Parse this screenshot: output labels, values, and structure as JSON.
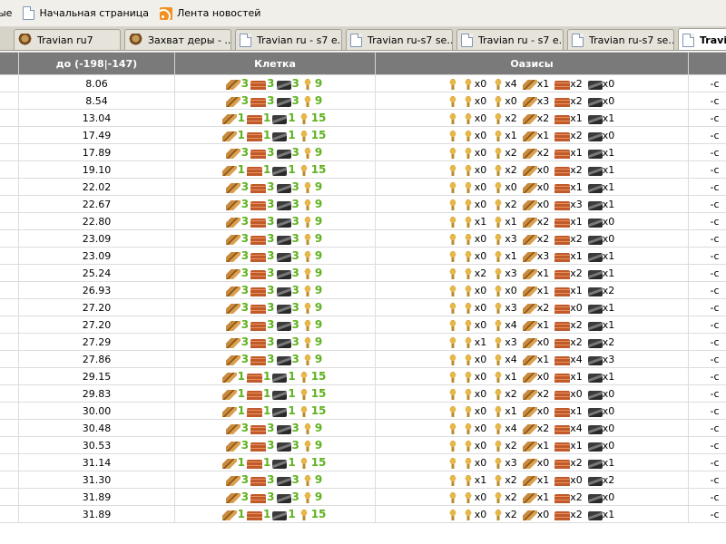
{
  "bookmarks": {
    "items": [
      {
        "label": "ые",
        "icon": "bookmark-item-icon"
      },
      {
        "label": "Начальная страница",
        "icon": "page-icon"
      },
      {
        "label": "Лента новостей",
        "icon": "rss-feed-icon"
      }
    ]
  },
  "tabs": [
    {
      "label": "Travian ru7",
      "icon": "travian-icon",
      "active": false
    },
    {
      "label": "Захват деры - ...",
      "icon": "travian-icon",
      "active": false
    },
    {
      "label": "Travian ru - s7 e...",
      "icon": "page-icon",
      "active": false
    },
    {
      "label": "Travian ru-s7 se...",
      "icon": "page-icon",
      "active": false
    },
    {
      "label": "Travian ru - s7 e...",
      "icon": "page-icon",
      "active": false
    },
    {
      "label": "Travian ru-s7 se...",
      "icon": "page-icon",
      "active": false
    },
    {
      "label": "Travi",
      "icon": "page-icon",
      "active": true
    }
  ],
  "table": {
    "columns": {
      "distance": "до (-198|-147)",
      "cell": "Клетка",
      "oases": "Оазисы",
      "extra": ""
    },
    "oasis_icons": [
      "crop-icon",
      "crop-icon",
      "crop-icon",
      "wood-icon",
      "clay-icon",
      "iron-icon"
    ],
    "rows": [
      {
        "distance": "8.06",
        "cell": [
          "3",
          "3",
          "3",
          "9"
        ],
        "oases": [
          "x0",
          "x4",
          "x1",
          "x2",
          "x0"
        ]
      },
      {
        "distance": "8.54",
        "cell": [
          "3",
          "3",
          "3",
          "9"
        ],
        "oases": [
          "x0",
          "x0",
          "x3",
          "x2",
          "x0"
        ]
      },
      {
        "distance": "13.04",
        "cell": [
          "1",
          "1",
          "1",
          "15"
        ],
        "oases": [
          "x0",
          "x2",
          "x2",
          "x1",
          "x1"
        ]
      },
      {
        "distance": "17.49",
        "cell": [
          "1",
          "1",
          "1",
          "15"
        ],
        "oases": [
          "x0",
          "x1",
          "x1",
          "x2",
          "x0"
        ]
      },
      {
        "distance": "17.89",
        "cell": [
          "3",
          "3",
          "3",
          "9"
        ],
        "oases": [
          "x0",
          "x2",
          "x2",
          "x1",
          "x1"
        ]
      },
      {
        "distance": "19.10",
        "cell": [
          "1",
          "1",
          "1",
          "15"
        ],
        "oases": [
          "x0",
          "x2",
          "x0",
          "x2",
          "x1"
        ]
      },
      {
        "distance": "22.02",
        "cell": [
          "3",
          "3",
          "3",
          "9"
        ],
        "oases": [
          "x0",
          "x0",
          "x0",
          "x1",
          "x1"
        ]
      },
      {
        "distance": "22.67",
        "cell": [
          "3",
          "3",
          "3",
          "9"
        ],
        "oases": [
          "x0",
          "x2",
          "x0",
          "x3",
          "x1"
        ]
      },
      {
        "distance": "22.80",
        "cell": [
          "3",
          "3",
          "3",
          "9"
        ],
        "oases": [
          "x1",
          "x1",
          "x2",
          "x1",
          "x0"
        ]
      },
      {
        "distance": "23.09",
        "cell": [
          "3",
          "3",
          "3",
          "9"
        ],
        "oases": [
          "x0",
          "x3",
          "x2",
          "x2",
          "x0"
        ]
      },
      {
        "distance": "23.09",
        "cell": [
          "3",
          "3",
          "3",
          "9"
        ],
        "oases": [
          "x0",
          "x1",
          "x3",
          "x1",
          "x1"
        ]
      },
      {
        "distance": "25.24",
        "cell": [
          "3",
          "3",
          "3",
          "9"
        ],
        "oases": [
          "x2",
          "x3",
          "x1",
          "x2",
          "x1"
        ]
      },
      {
        "distance": "26.93",
        "cell": [
          "3",
          "3",
          "3",
          "9"
        ],
        "oases": [
          "x0",
          "x0",
          "x1",
          "x1",
          "x2"
        ]
      },
      {
        "distance": "27.20",
        "cell": [
          "3",
          "3",
          "3",
          "9"
        ],
        "oases": [
          "x0",
          "x3",
          "x2",
          "x0",
          "x1"
        ]
      },
      {
        "distance": "27.20",
        "cell": [
          "3",
          "3",
          "3",
          "9"
        ],
        "oases": [
          "x0",
          "x4",
          "x1",
          "x2",
          "x1"
        ]
      },
      {
        "distance": "27.29",
        "cell": [
          "3",
          "3",
          "3",
          "9"
        ],
        "oases": [
          "x1",
          "x3",
          "x0",
          "x2",
          "x2"
        ]
      },
      {
        "distance": "27.86",
        "cell": [
          "3",
          "3",
          "3",
          "9"
        ],
        "oases": [
          "x0",
          "x4",
          "x1",
          "x4",
          "x3"
        ]
      },
      {
        "distance": "29.15",
        "cell": [
          "1",
          "1",
          "1",
          "15"
        ],
        "oases": [
          "x0",
          "x1",
          "x0",
          "x1",
          "x1"
        ]
      },
      {
        "distance": "29.83",
        "cell": [
          "1",
          "1",
          "1",
          "15"
        ],
        "oases": [
          "x0",
          "x2",
          "x2",
          "x0",
          "x0"
        ]
      },
      {
        "distance": "30.00",
        "cell": [
          "1",
          "1",
          "1",
          "15"
        ],
        "oases": [
          "x0",
          "x1",
          "x0",
          "x1",
          "x0"
        ]
      },
      {
        "distance": "30.48",
        "cell": [
          "3",
          "3",
          "3",
          "9"
        ],
        "oases": [
          "x0",
          "x4",
          "x2",
          "x4",
          "x0"
        ]
      },
      {
        "distance": "30.53",
        "cell": [
          "3",
          "3",
          "3",
          "9"
        ],
        "oases": [
          "x0",
          "x2",
          "x1",
          "x1",
          "x0"
        ]
      },
      {
        "distance": "31.14",
        "cell": [
          "1",
          "1",
          "1",
          "15"
        ],
        "oases": [
          "x0",
          "x3",
          "x0",
          "x2",
          "x1"
        ]
      },
      {
        "distance": "31.30",
        "cell": [
          "3",
          "3",
          "3",
          "9"
        ],
        "oases": [
          "x1",
          "x2",
          "x1",
          "x0",
          "x2"
        ]
      },
      {
        "distance": "31.89",
        "cell": [
          "3",
          "3",
          "3",
          "9"
        ],
        "oases": [
          "x0",
          "x2",
          "x1",
          "x2",
          "x0"
        ]
      },
      {
        "distance": "31.89",
        "cell": [
          "1",
          "1",
          "1",
          "15"
        ],
        "oases": [
          "x0",
          "x2",
          "x0",
          "x2",
          "x1"
        ]
      }
    ],
    "extra_cell": "-c"
  },
  "colors": {
    "header_bg": "#7a7a7a",
    "number_green": "#5fb21e"
  }
}
